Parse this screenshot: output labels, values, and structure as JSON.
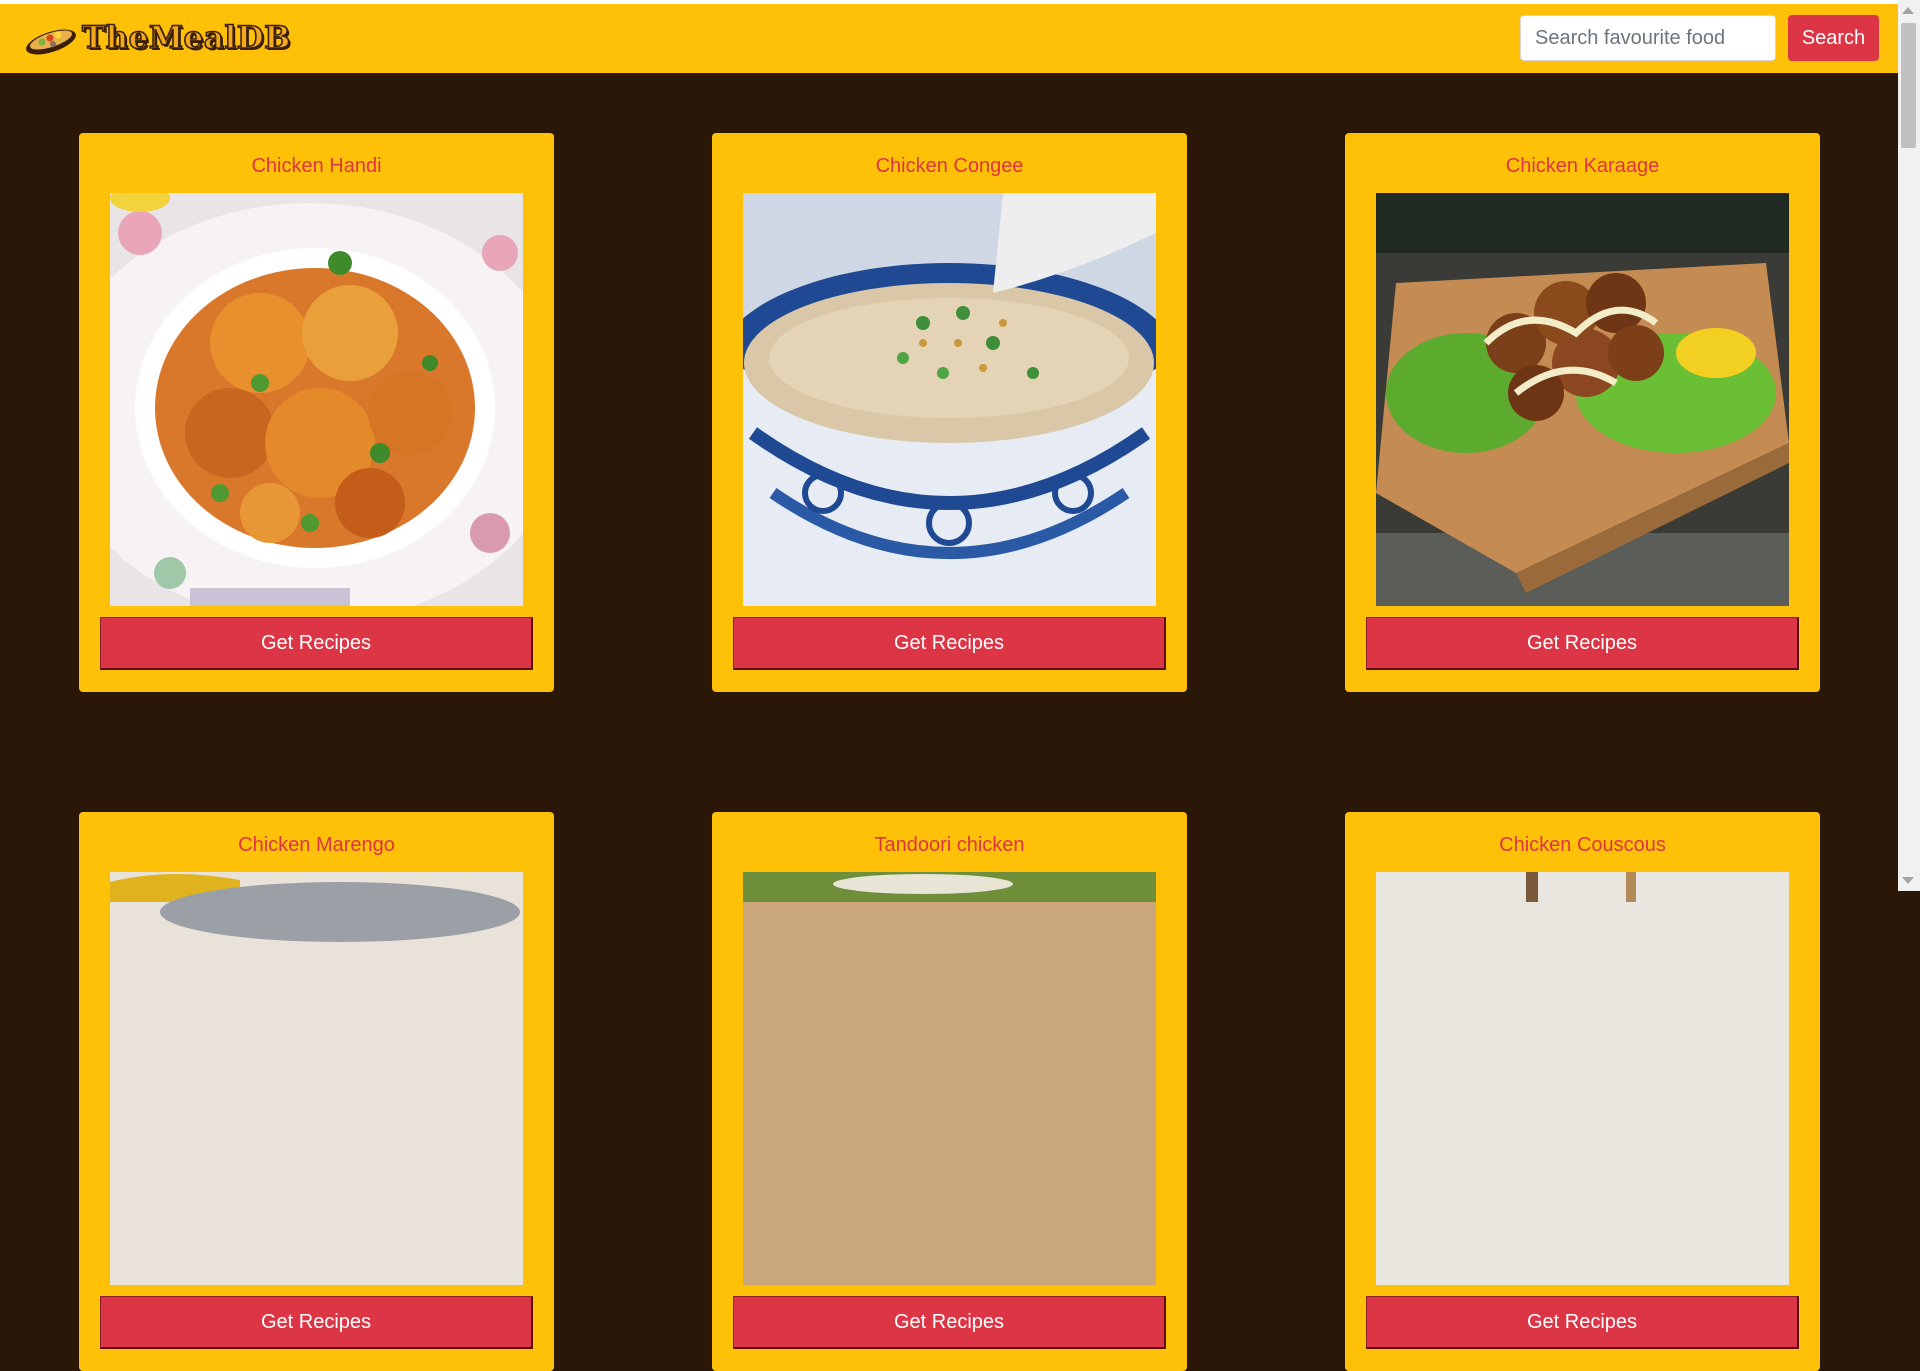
{
  "navbar": {
    "logo_text": "TheMealDB",
    "search_placeholder": "Search favourite food",
    "search_value": "",
    "search_button_label": "Search"
  },
  "meals": [
    {
      "name": "Chicken Handi",
      "button_label": "Get Recipes"
    },
    {
      "name": "Chicken Congee",
      "button_label": "Get Recipes"
    },
    {
      "name": "Chicken Karaage",
      "button_label": "Get Recipes"
    },
    {
      "name": "Chicken Marengo",
      "button_label": "Get Recipes"
    },
    {
      "name": "Tandoori chicken",
      "button_label": "Get Recipes"
    },
    {
      "name": "Chicken Couscous",
      "button_label": "Get Recipes"
    }
  ],
  "colors": {
    "page_background": "#2b1708",
    "navbar_background": "#ffc107",
    "card_background": "#ffc107",
    "accent_red": "#dc3545",
    "button_text": "#ffffff"
  },
  "icons": {
    "logo": "food-tray-icon",
    "scroll_up": "scroll-up-arrow-icon",
    "scroll_down": "scroll-down-arrow-icon"
  }
}
